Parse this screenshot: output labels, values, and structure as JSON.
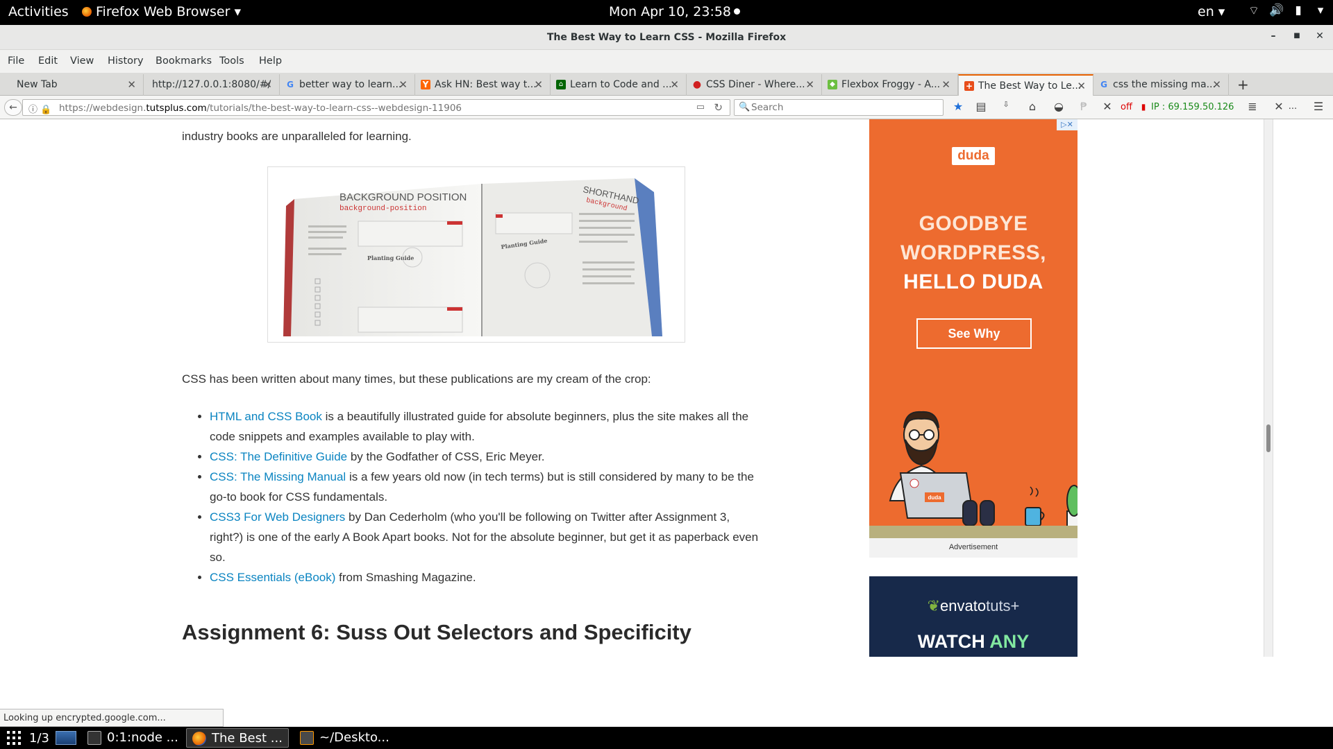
{
  "topbar": {
    "activities": "Activities",
    "app_menu": "Firefox Web Browser",
    "clock": "Mon Apr 10, 23:58",
    "language": "en"
  },
  "window": {
    "title": "The Best Way to Learn CSS - Mozilla Firefox"
  },
  "menus": [
    "File",
    "Edit",
    "View",
    "History",
    "Bookmarks",
    "Tools",
    "Help"
  ],
  "tabs": [
    {
      "label": "New Tab",
      "favicon": "blank-icon",
      "active": false
    },
    {
      "label": "http://127.0.0.1:8080/#/",
      "favicon": "blank-icon",
      "active": false
    },
    {
      "label": "better way to learn...",
      "favicon": "google-icon",
      "active": false
    },
    {
      "label": "Ask HN: Best way t...",
      "favicon": "hn-icon",
      "active": false
    },
    {
      "label": "Learn to Code and ...",
      "favicon": "fcc-icon",
      "active": false
    },
    {
      "label": "CSS Diner - Where...",
      "favicon": "css-diner-icon",
      "active": false
    },
    {
      "label": "Flexbox Froggy - A...",
      "favicon": "froggy-icon",
      "active": false
    },
    {
      "label": "The Best Way to Le...",
      "favicon": "tutsplus-icon",
      "active": true
    },
    {
      "label": "css the missing ma...",
      "favicon": "google-icon",
      "active": false
    }
  ],
  "navbar": {
    "url_prefix": "https://webdesign.",
    "url_domain": "tutsplus.com",
    "url_path": "/tutorials/the-best-way-to-learn-css--webdesign-11906",
    "search_placeholder": "Search",
    "proxy_status": "off",
    "ip_text": "IP : 69.159.50.126",
    "overflow": "..."
  },
  "article": {
    "intro_line": "industry books are unparalleled for learning.",
    "figure_title": "BACKGROUND POSITION",
    "figure_subtitle": "background-position",
    "figure_right_title": "SHORTHAND",
    "figure_right_subtitle": "background",
    "figure_left_heading": "Planting Guide",
    "figure_right_heading": "Planting Guide",
    "body_para": "CSS has been written about many times, but these publications are my cream of the crop:",
    "books": [
      {
        "link": "HTML and CSS Book",
        "text": " is a beautifully illustrated guide for absolute beginners, plus the site makes all the code snippets and examples available to play with."
      },
      {
        "link": "CSS: The Definitive Guide",
        "text": " by the Godfather of CSS, Eric Meyer."
      },
      {
        "link": "CSS: The Missing Manual",
        "text": " is a few years old now (in tech terms) but is still considered by many to be the go-to book for CSS fundamentals."
      },
      {
        "link": "CSS3 For Web Designers",
        "text": " by Dan Cederholm (who you'll be following on Twitter after Assignment 3, right?) is one of the early A Book Apart books. Not for the absolute beginner, but get it as paperback even so."
      },
      {
        "link": "CSS Essentials (eBook)",
        "text": " from Smashing Magazine."
      }
    ],
    "section_heading": "Assignment 6: Suss Out Selectors and Specificity"
  },
  "ads": {
    "duda_logo": "duda",
    "duda_line1": "GOODBYE",
    "duda_line2": "WORDPRESS,",
    "duda_line3": "HELLO DUDA",
    "duda_button": "See Why",
    "laptop_sticker": "duda",
    "ad_label": "Advertisement",
    "envato_logo_main": "envato",
    "envato_logo_suffix": "tuts+",
    "envato_head_a": "WATCH ",
    "envato_head_b": "ANY",
    "accent_orange": "#ed6b2f"
  },
  "status_text": "Looking up encrypted.google.com...",
  "taskbar": {
    "workspace": "1/3",
    "tasks": [
      {
        "label": "0:1:node ...",
        "icon": "terminal-icon",
        "active": false
      },
      {
        "label": "The Best ...",
        "icon": "firefox-icon",
        "active": true
      },
      {
        "label": "~/Deskto...",
        "icon": "sublime-icon",
        "active": false
      }
    ]
  }
}
